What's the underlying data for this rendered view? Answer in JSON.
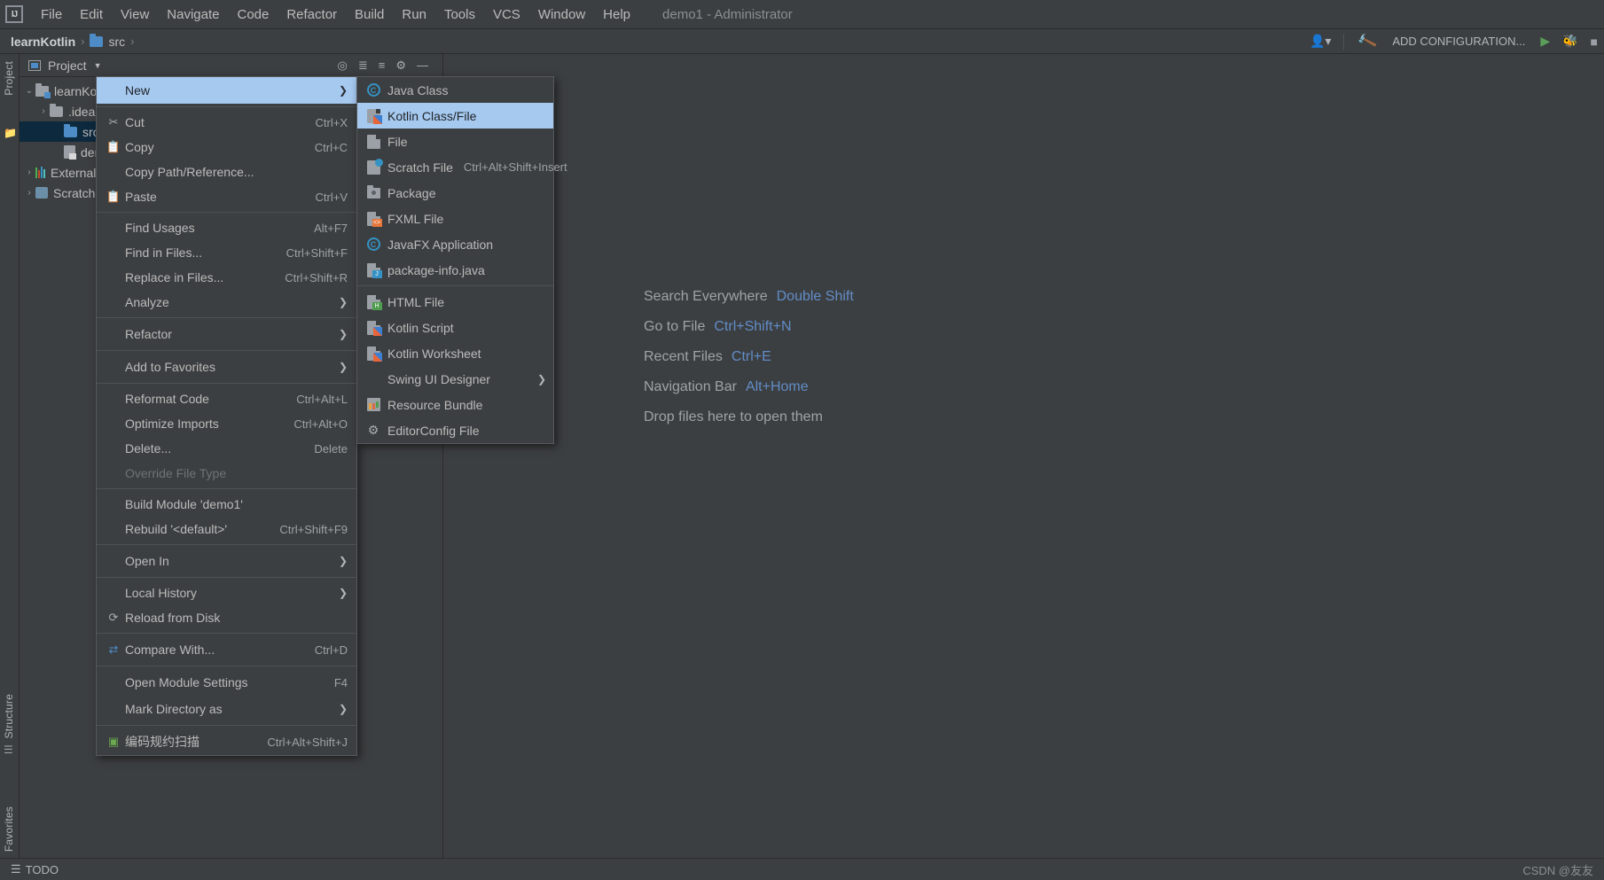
{
  "window": {
    "title": "demo1 - Administrator",
    "accent_blue": "#4d8cc7",
    "menu_highlight": "#a6c9f0",
    "bg": "#3c3f41"
  },
  "menubar": {
    "logo": "IJ",
    "items": [
      {
        "label": "File",
        "mnemonic": "F"
      },
      {
        "label": "Edit",
        "mnemonic": "E"
      },
      {
        "label": "View",
        "mnemonic": "V"
      },
      {
        "label": "Navigate",
        "mnemonic": "N"
      },
      {
        "label": "Code",
        "mnemonic": "C"
      },
      {
        "label": "Refactor",
        "mnemonic": "R"
      },
      {
        "label": "Build",
        "mnemonic": "B"
      },
      {
        "label": "Run",
        "mnemonic": "u"
      },
      {
        "label": "Tools",
        "mnemonic": "T"
      },
      {
        "label": "VCS",
        "mnemonic": "S"
      },
      {
        "label": "Window",
        "mnemonic": "W"
      },
      {
        "label": "Help",
        "mnemonic": "H"
      }
    ]
  },
  "navbar": {
    "project_name": "learnKotlin",
    "separator": "›",
    "crumbs": [
      {
        "label": "src",
        "icon": "folder-icon"
      }
    ],
    "add_configuration": "ADD CONFIGURATION...",
    "icons": [
      "user-dropdown-icon",
      "hammer-build-icon",
      "run-icon",
      "debug-icon",
      "stop-icon"
    ]
  },
  "left_strip": {
    "project_tab": "Project",
    "structure_tab": "Structure",
    "favorites_tab": "Favorites"
  },
  "project_panel": {
    "title": "Project",
    "toolbar_icons": [
      "locate-icon",
      "expand-all-icon",
      "collapse-all-icon",
      "settings-gear-icon",
      "hide-icon"
    ],
    "tree": [
      {
        "label": "learnKotlin",
        "icon": "module-icon",
        "indent": 0,
        "arrow": "⌄",
        "selected": false
      },
      {
        "label": ".idea",
        "icon": "folder-icon",
        "indent": 1,
        "arrow": "›",
        "selected": false
      },
      {
        "label": "src",
        "icon": "folder-source-icon",
        "indent": 2,
        "arrow": "",
        "selected": true
      },
      {
        "label": "demo1.iml",
        "icon": "iml-file-icon",
        "indent": 2,
        "arrow": "",
        "selected": false
      },
      {
        "label": "External Libraries",
        "icon": "libraries-icon",
        "indent": 0,
        "arrow": "›",
        "selected": false
      },
      {
        "label": "Scratches and Consoles",
        "icon": "scratches-icon",
        "indent": 0,
        "arrow": "›",
        "selected": false
      }
    ]
  },
  "editor_hints": [
    {
      "label": "Search Everywhere",
      "key": "Double Shift"
    },
    {
      "label": "Go to File",
      "key": "Ctrl+Shift+N"
    },
    {
      "label": "Recent Files",
      "key": "Ctrl+E"
    },
    {
      "label": "Navigation Bar",
      "key": "Alt+Home"
    },
    {
      "label": "Drop files here to open them",
      "key": ""
    }
  ],
  "context_menu": {
    "items": [
      {
        "label": "New",
        "mnemonic": "",
        "key": "",
        "icon": "",
        "arrow": true,
        "highlighted": true,
        "sep_after": true
      },
      {
        "label": "Cut",
        "mnemonic": "t",
        "key": "Ctrl+X",
        "icon": "cut-scissors-icon",
        "arrow": false
      },
      {
        "label": "Copy",
        "mnemonic": "C",
        "key": "Ctrl+C",
        "icon": "copy-icon",
        "arrow": false
      },
      {
        "label": "Copy Path/Reference...",
        "mnemonic": "",
        "key": "",
        "icon": "",
        "arrow": false
      },
      {
        "label": "Paste",
        "mnemonic": "P",
        "key": "Ctrl+V",
        "icon": "paste-clipboard-icon",
        "arrow": false,
        "sep_after": true
      },
      {
        "label": "Find Usages",
        "mnemonic": "U",
        "key": "Alt+F7",
        "icon": "",
        "arrow": false
      },
      {
        "label": "Find in Files...",
        "mnemonic": "",
        "key": "Ctrl+Shift+F",
        "icon": "",
        "arrow": false
      },
      {
        "label": "Replace in Files...",
        "mnemonic": "",
        "key": "Ctrl+Shift+R",
        "icon": "",
        "arrow": false
      },
      {
        "label": "Analyze",
        "mnemonic": "",
        "key": "",
        "icon": "",
        "arrow": true,
        "sep_after": true
      },
      {
        "label": "Refactor",
        "mnemonic": "R",
        "key": "",
        "icon": "",
        "arrow": true,
        "sep_after": true
      },
      {
        "label": "Add to Favorites",
        "mnemonic": "v",
        "key": "",
        "icon": "",
        "arrow": true,
        "sep_after": true
      },
      {
        "label": "Reformat Code",
        "mnemonic": "R",
        "key": "Ctrl+Alt+L",
        "icon": "",
        "arrow": false
      },
      {
        "label": "Optimize Imports",
        "mnemonic": "z",
        "key": "Ctrl+Alt+O",
        "icon": "",
        "arrow": false
      },
      {
        "label": "Delete...",
        "mnemonic": "D",
        "key": "Delete",
        "icon": "",
        "arrow": false
      },
      {
        "label": "Override File Type",
        "mnemonic": "",
        "key": "",
        "icon": "",
        "arrow": false,
        "disabled": true,
        "sep_after": true
      },
      {
        "label": "Build Module 'demo1'",
        "mnemonic": "M",
        "key": "",
        "icon": "",
        "arrow": false
      },
      {
        "label": "Rebuild '<default>'",
        "mnemonic": "e",
        "key": "Ctrl+Shift+F9",
        "icon": "",
        "arrow": false,
        "sep_after": true
      },
      {
        "label": "Open In",
        "mnemonic": "",
        "key": "",
        "icon": "",
        "arrow": true,
        "sep_after": true
      },
      {
        "label": "Local History",
        "mnemonic": "H",
        "key": "",
        "icon": "",
        "arrow": true
      },
      {
        "label": "Reload from Disk",
        "mnemonic": "",
        "key": "",
        "icon": "reload-icon",
        "arrow": false,
        "sep_after": true
      },
      {
        "label": "Compare With...",
        "mnemonic": "",
        "key": "Ctrl+D",
        "icon": "compare-icon",
        "arrow": false,
        "sep_after": true
      },
      {
        "label": "Open Module Settings",
        "mnemonic": "",
        "key": "F4",
        "icon": "",
        "arrow": false
      },
      {
        "label": "Mark Directory as",
        "mnemonic": "",
        "key": "",
        "icon": "",
        "arrow": true,
        "sep_after": true
      },
      {
        "label": "编码规约扫描",
        "mnemonic": "",
        "key": "Ctrl+Alt+Shift+J",
        "icon": "scan-icon",
        "arrow": false
      }
    ]
  },
  "submenu_new": {
    "items": [
      {
        "label": "Java Class",
        "key": "",
        "icon": "java-class-icon",
        "arrow": false
      },
      {
        "label": "Kotlin Class/File",
        "key": "",
        "icon": "kotlin-file-icon",
        "arrow": false,
        "highlighted": true
      },
      {
        "label": "File",
        "key": "",
        "icon": "file-icon",
        "arrow": false
      },
      {
        "label": "Scratch File",
        "key": "Ctrl+Alt+Shift+Insert",
        "icon": "scratch-file-icon",
        "arrow": false
      },
      {
        "label": "Package",
        "key": "",
        "icon": "package-icon",
        "arrow": false
      },
      {
        "label": "FXML File",
        "key": "",
        "icon": "fxml-file-icon",
        "arrow": false
      },
      {
        "label": "JavaFX Application",
        "key": "",
        "icon": "javafx-application-icon",
        "arrow": false
      },
      {
        "label": "package-info.java",
        "key": "",
        "icon": "package-info-icon",
        "arrow": false,
        "sep_after": true
      },
      {
        "label": "HTML File",
        "key": "",
        "icon": "html-file-icon",
        "arrow": false
      },
      {
        "label": "Kotlin Script",
        "key": "",
        "icon": "kotlin-file-icon",
        "arrow": false
      },
      {
        "label": "Kotlin Worksheet",
        "key": "",
        "icon": "kotlin-file-icon",
        "arrow": false
      },
      {
        "label": "Swing UI Designer",
        "key": "",
        "icon": "",
        "arrow": true
      },
      {
        "label": "Resource Bundle",
        "key": "",
        "icon": "resource-bundle-icon",
        "arrow": false
      },
      {
        "label": "EditorConfig File",
        "key": "",
        "icon": "editorconfig-icon",
        "arrow": false
      }
    ]
  },
  "bottom_bar": {
    "todo_label": "TODO",
    "watermark": "CSDN @友友"
  }
}
